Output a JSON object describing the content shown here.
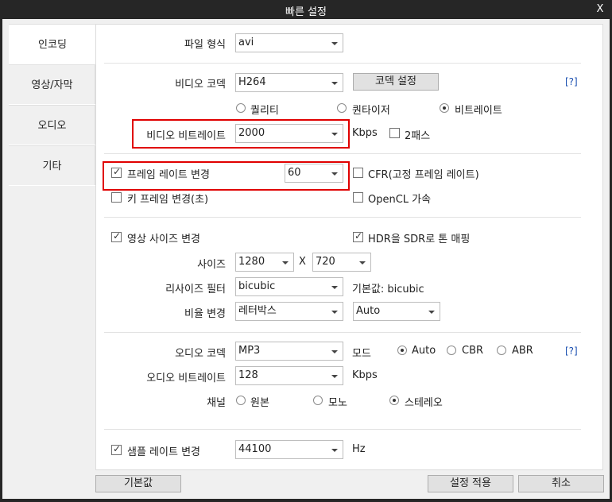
{
  "window": {
    "title": "빠른 설정",
    "close_label": "X"
  },
  "sidebar": {
    "items": [
      {
        "label": "인코딩"
      },
      {
        "label": "영상/자막"
      },
      {
        "label": "오디오"
      },
      {
        "label": "기타"
      }
    ]
  },
  "file_format": {
    "label": "파일 형식",
    "value": "avi"
  },
  "video_codec": {
    "label": "비디오 코덱",
    "value": "H264",
    "settings_button": "코덱 설정",
    "help": "[?]"
  },
  "rate_mode": {
    "options": [
      "퀄리티",
      "퀀타이저",
      "비트레이트"
    ],
    "selected": "비트레이트"
  },
  "video_bitrate": {
    "label": "비디오 비트레이트",
    "value": "2000",
    "unit": "Kbps",
    "two_pass_label": "2패스"
  },
  "frame_rate": {
    "label": "프레임 레이트 변경",
    "value": "60",
    "cfr_label": "CFR(고정 프레임 레이트)"
  },
  "keyframe": {
    "label": "키 프레임 변경(초)",
    "opencl_label": "OpenCL 가속"
  },
  "resize": {
    "label": "영상 사이즈 변경",
    "hdr_label": "HDR을 SDR로 톤 매핑"
  },
  "size": {
    "label": "사이즈",
    "width": "1280",
    "x_label": "X",
    "height": "720"
  },
  "resize_filter": {
    "label": "리사이즈 필터",
    "value": "bicubic",
    "default_text": "기본값: bicubic"
  },
  "aspect": {
    "label": "비율 변경",
    "value": "레터박스",
    "ratio_value": "Auto"
  },
  "audio_codec": {
    "label": "오디오 코덱",
    "value": "MP3",
    "mode_label": "모드",
    "modes": [
      "Auto",
      "CBR",
      "ABR"
    ],
    "selected_mode": "Auto",
    "help": "[?]"
  },
  "audio_bitrate": {
    "label": "오디오 비트레이트",
    "value": "128",
    "unit": "Kbps"
  },
  "channel": {
    "label": "채널",
    "options": [
      "원본",
      "모노",
      "스테레오"
    ],
    "selected": "스테레오"
  },
  "sample_rate": {
    "label": "샘플 레이트 변경",
    "value": "44100",
    "unit": "Hz"
  },
  "footer": {
    "default_button": "기본값",
    "apply_button": "설정 적용",
    "cancel_button": "취소"
  },
  "colors": {
    "highlight_box": "#e00000",
    "help_link": "#1a4fb0",
    "titlebar": "#262626"
  }
}
